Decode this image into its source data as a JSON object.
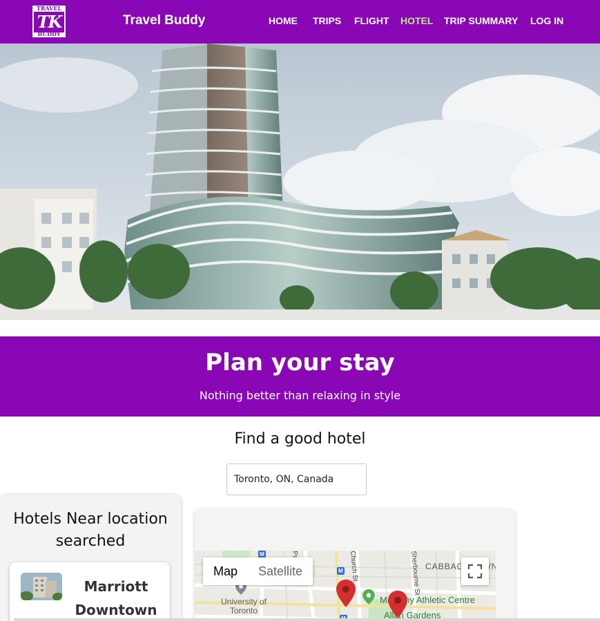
{
  "navbar": {
    "logo_top": "TRAVEL",
    "logo_mark": "TK",
    "logo_bottom": "BUDDY",
    "brand": "Travel Buddy",
    "links": [
      {
        "label": "HOME"
      },
      {
        "label": "TRIPS"
      },
      {
        "label": "FLIGHT"
      },
      {
        "label": "HOTEL",
        "active": true
      },
      {
        "label": "TRIP SUMMARY"
      },
      {
        "label": "LOG IN"
      }
    ],
    "active_color": "#b8e986"
  },
  "banner": {
    "title": "Plan your stay",
    "subtitle": "Nothing better than relaxing in style"
  },
  "search": {
    "title": "Find a good hotel",
    "value": "Toronto, ON, Canada"
  },
  "hotels": {
    "title": "Hotels Near location searched",
    "items": [
      {
        "name": "Marriott Downtown"
      }
    ]
  },
  "map": {
    "toggle": [
      "Map",
      "Satellite"
    ],
    "selected": "Map",
    "labels": {
      "university": "University of Toronto",
      "athletic": "Mattamy Athletic Centre",
      "gardens": "Allan Gardens",
      "cabbagetown": "CABBAGETOWN",
      "park": "Park Cres",
      "church": "Church St",
      "sherbourne": "Sherbourne St",
      "metro": "M"
    }
  },
  "colors": {
    "brand": "#8a07b5",
    "pin": "#d32f2f"
  }
}
